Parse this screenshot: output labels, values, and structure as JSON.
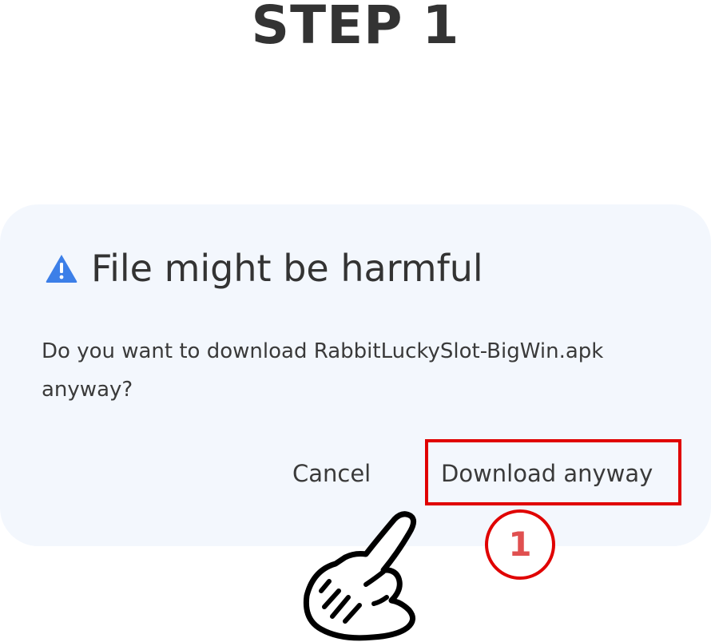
{
  "step": {
    "title": "STEP 1",
    "marker_number": "1"
  },
  "dialog": {
    "icon": "warning-icon",
    "title": "File might be harmful",
    "message": "Do you want to download RabbitLuckySlot-BigWin.apk anyway?",
    "buttons": {
      "cancel_label": "Cancel",
      "download_label": "Download anyway"
    }
  },
  "colors": {
    "dialog_background": "#f3f7fd",
    "warning_icon": "#3c7fe8",
    "highlight": "#e00000",
    "title_text": "#333333"
  },
  "annotation": {
    "pointer": "pointing-hand-icon",
    "highlight_target": "Download anyway"
  }
}
